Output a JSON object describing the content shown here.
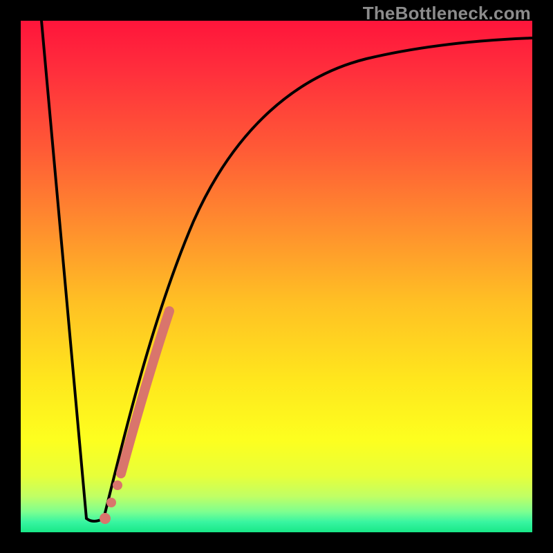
{
  "chart_data": {
    "type": "line",
    "title": "",
    "xlabel": "",
    "ylabel": "",
    "watermark": "TheBottleneck.com",
    "xlim": [
      0,
      100
    ],
    "ylim": [
      0,
      100
    ],
    "background_gradient_meaning": "red=high bottleneck, green=low bottleneck",
    "series": [
      {
        "name": "bottleneck-curve",
        "x": [
          4,
          6,
          8,
          10,
          12,
          13,
          14,
          16,
          20,
          25,
          30,
          40,
          50,
          60,
          70,
          80,
          90,
          100
        ],
        "values": [
          100,
          78,
          56,
          34,
          12,
          3,
          2,
          6,
          20,
          40,
          55,
          73,
          83,
          89,
          92,
          94,
          95,
          96
        ]
      }
    ],
    "highlight": {
      "name": "suggested-range",
      "x": [
        16,
        18,
        20,
        23,
        26,
        29
      ],
      "values": [
        3,
        7,
        12,
        22,
        33,
        43
      ],
      "color": "#d9756c"
    },
    "dots": [
      {
        "x": 16.5,
        "y": 3
      },
      {
        "x": 17.5,
        "y": 6
      },
      {
        "x": 19,
        "y": 10
      }
    ],
    "colors": {
      "curve": "#000000",
      "highlight": "#d9756c",
      "gradient_top": "#ff153b",
      "gradient_bottom": "#18e887",
      "frame": "#000000"
    }
  }
}
